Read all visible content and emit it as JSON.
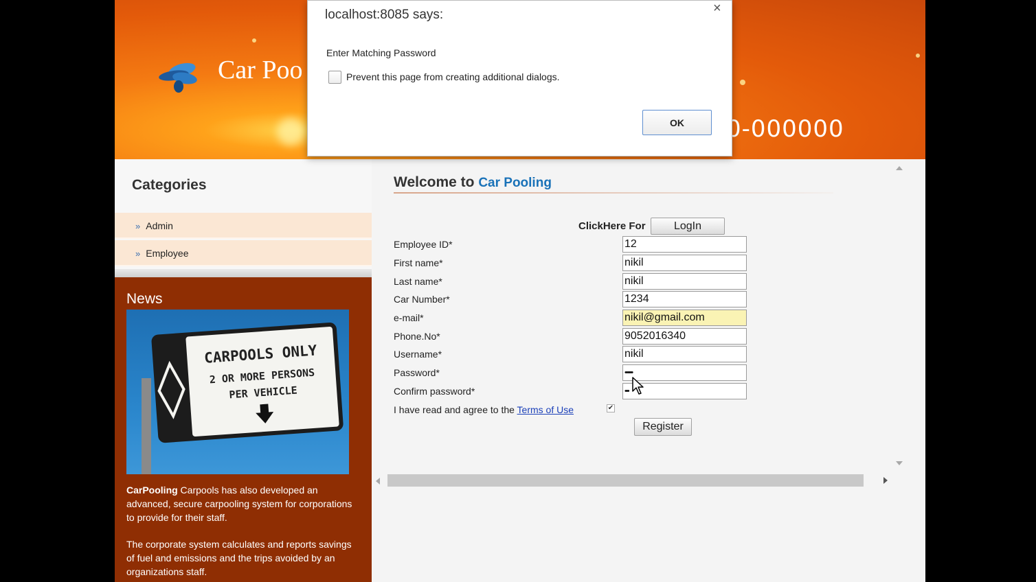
{
  "header": {
    "site_title": "Car Poo",
    "phone_fragment": "0-000000"
  },
  "sidebar": {
    "categories_title": "Categories",
    "items": [
      {
        "label": "Admin"
      },
      {
        "label": "Employee"
      }
    ],
    "news": {
      "title": "News",
      "image_sign_lines": [
        "CARPOOLS ONLY",
        "2 OR MORE PERSONS",
        "PER VEHICLE"
      ],
      "brand": "CarPooling",
      "paragraph1": " Carpools has also developed an advanced, secure carpooling system for corporations to provide for their staff.",
      "paragraph2": "The corporate system calculates and reports savings of fuel and emissions and the trips avoided by an organizations staff."
    }
  },
  "main": {
    "welcome_prefix": "Welcome to ",
    "welcome_accent": "Car Pooling",
    "click_here_label": "ClickHere For",
    "login_button": "LogIn",
    "fields": [
      {
        "label": "Employee ID*",
        "value": "12"
      },
      {
        "label": "First name*",
        "value": "nikil"
      },
      {
        "label": "Last name*",
        "value": "nikil"
      },
      {
        "label": "Car Number*",
        "value": "1234"
      },
      {
        "label": "e-mail*",
        "value": "nikil@gmail.com"
      },
      {
        "label": "Phone.No*",
        "value": "9052016340"
      },
      {
        "label": "Username*",
        "value": "nikil"
      },
      {
        "label": "Password*",
        "value": "••••••"
      },
      {
        "label": "Confirm password*",
        "value": "•••"
      }
    ],
    "agree_text": "I have read and agree to the ",
    "terms_link": "Terms of Use",
    "agree_checked": true,
    "register_button": "Register"
  },
  "dialog": {
    "title": "localhost:8085 says:",
    "close_glyph": "×",
    "message": "Enter Matching Password",
    "checkbox_label": "Prevent this page from creating additional dialogs.",
    "ok_button": "OK"
  },
  "colors": {
    "accent": "#1a72b8",
    "header_orange": "#f47a12",
    "news_bg": "#8f2e03",
    "autofill": "#faf3b4"
  }
}
